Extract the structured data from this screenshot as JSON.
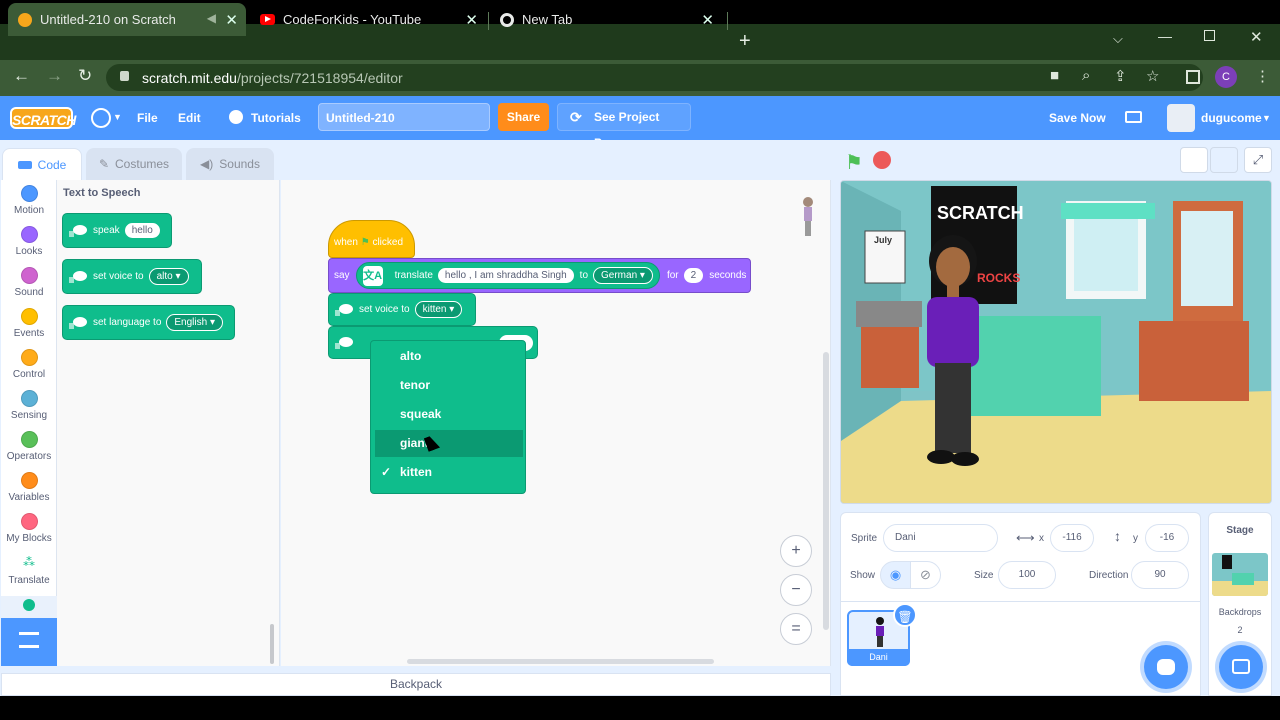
{
  "browser": {
    "tabs": [
      {
        "title": "Untitled-210 on Scratch"
      },
      {
        "title": "CodeForKids - YouTube"
      },
      {
        "title": "New Tab"
      }
    ],
    "url_host": "scratch.mit.edu",
    "url_path": "/projects/721518954/editor",
    "profile_initial": "C"
  },
  "menu": {
    "logo": "SCRATCH",
    "file": "File",
    "edit": "Edit",
    "tutorials": "Tutorials",
    "project_title": "Untitled-210",
    "share": "Share",
    "see_project_page": "See Project Page",
    "save_now": "Save Now",
    "username": "dugucome"
  },
  "editor_tabs": {
    "code": "Code",
    "costumes": "Costumes",
    "sounds": "Sounds"
  },
  "categories": [
    {
      "label": "Motion",
      "color": "#4c97ff"
    },
    {
      "label": "Looks",
      "color": "#9966ff"
    },
    {
      "label": "Sound",
      "color": "#cf63cf"
    },
    {
      "label": "Events",
      "color": "#ffbf00"
    },
    {
      "label": "Control",
      "color": "#ffab19"
    },
    {
      "label": "Sensing",
      "color": "#5cb1d6"
    },
    {
      "label": "Operators",
      "color": "#59c059"
    },
    {
      "label": "Variables",
      "color": "#ff8c1a"
    },
    {
      "label": "My Blocks",
      "color": "#ff6680"
    },
    {
      "label": "Translate"
    }
  ],
  "palette": {
    "heading": "Text to Speech",
    "speak": {
      "label": "speak",
      "value": "hello"
    },
    "set_voice": {
      "label": "set voice to",
      "value": "alto"
    },
    "set_language": {
      "label": "set language to",
      "value": "English"
    }
  },
  "script": {
    "hat": {
      "when": "when",
      "clicked": "clicked"
    },
    "say": {
      "say": "say",
      "translate": "translate",
      "text": "hello ,  I am shraddha Singh",
      "to": "to",
      "language": "German",
      "for": "for",
      "secs": "2",
      "seconds": "seconds"
    },
    "set_voice": {
      "label": "set voice to",
      "value": "kitten"
    }
  },
  "voice_dropdown": {
    "options": [
      "alto",
      "tenor",
      "squeak",
      "giant",
      "kitten"
    ],
    "selected": "kitten",
    "hovered": "giant"
  },
  "backpack": "Backpack",
  "sprite_info": {
    "sprite_label": "Sprite",
    "sprite_name": "Dani",
    "x_label": "x",
    "x": "-116",
    "y_label": "y",
    "y": "-16",
    "show_label": "Show",
    "size_label": "Size",
    "size": "100",
    "direction_label": "Direction",
    "direction": "90"
  },
  "sprite_tile": {
    "name": "Dani"
  },
  "stage_panel": {
    "title": "Stage",
    "backdrops_label": "Backdrops",
    "backdrops_count": "2"
  },
  "stage_scene": {
    "calendar": "July",
    "poster": "SCRATCH",
    "poster2": "ROCKS"
  }
}
